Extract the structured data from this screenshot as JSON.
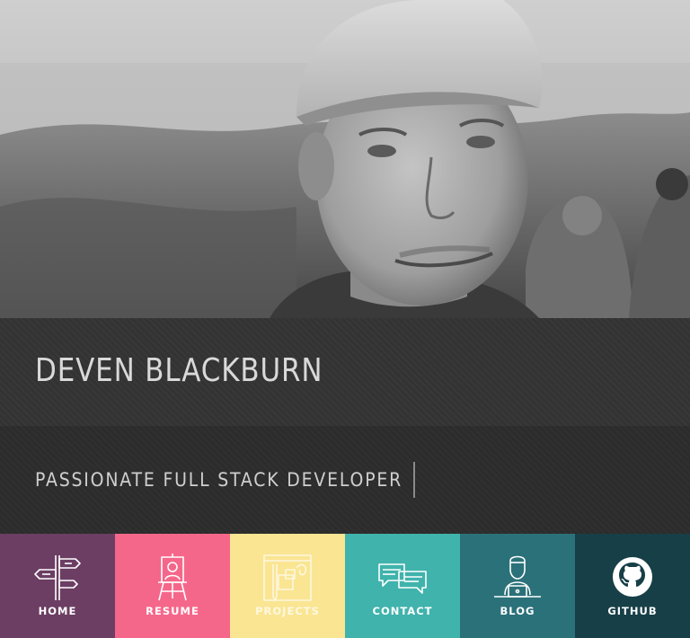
{
  "profile": {
    "name": "DEVEN BLACKBURN",
    "tagline": "PASSIONATE FULL STACK DEVELOPER"
  },
  "nav": {
    "items": [
      {
        "label": "HOME",
        "icon": "signpost-icon",
        "color": "#6c3e63"
      },
      {
        "label": "RESUME",
        "icon": "easel-portrait-icon",
        "color": "#f5678a"
      },
      {
        "label": "PROJECTS",
        "icon": "blueprint-icon",
        "color": "#fae593"
      },
      {
        "label": "CONTACT",
        "icon": "chat-bubbles-icon",
        "color": "#3fb3ac"
      },
      {
        "label": "BLOG",
        "icon": "person-laptop-icon",
        "color": "#2b7179"
      },
      {
        "label": "GITHUB",
        "icon": "github-icon",
        "color": "#173f47"
      }
    ]
  }
}
